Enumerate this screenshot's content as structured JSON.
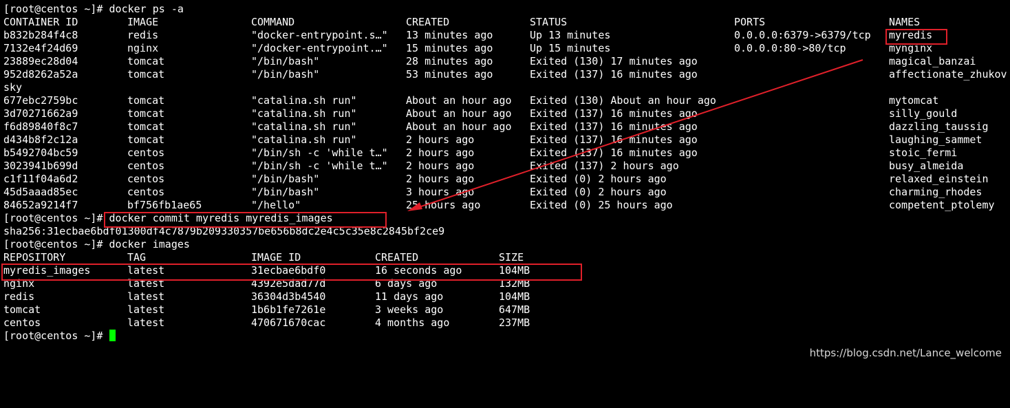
{
  "terminal": {
    "prompt": "[root@centos ~]# ",
    "cmd_ps": "docker ps -a",
    "ps_headers": [
      "CONTAINER ID",
      "IMAGE",
      "COMMAND",
      "CREATED",
      "STATUS",
      "PORTS",
      "NAMES"
    ],
    "containers": [
      {
        "id": "b832b284f4c8",
        "image": "redis",
        "command": "\"docker-entrypoint.s…\"",
        "created": "13 minutes ago",
        "status": "Up 13 minutes",
        "ports": "0.0.0.0:6379->6379/tcp",
        "name": "myredis"
      },
      {
        "id": "7132e4f24d69",
        "image": "nginx",
        "command": "\"/docker-entrypoint.…\"",
        "created": "15 minutes ago",
        "status": "Up 15 minutes",
        "ports": "0.0.0.0:80->80/tcp",
        "name": "mynginx"
      },
      {
        "id": "23889ec28d04",
        "image": "tomcat",
        "command": "\"/bin/bash\"",
        "created": "28 minutes ago",
        "status": "Exited (130) 17 minutes ago",
        "ports": "",
        "name": "magical_banzai"
      },
      {
        "id": "952d8262a52a",
        "image": "tomcat",
        "command": "\"/bin/bash\"",
        "created": "53 minutes ago",
        "status": "Exited (137) 16 minutes ago",
        "ports": "",
        "name": "affectionate_zhukov"
      },
      {
        "id": "677ebc2759bc",
        "image": "tomcat",
        "command": "\"catalina.sh run\"",
        "created": "About an hour ago",
        "status": "Exited (130) About an hour ago",
        "ports": "",
        "name": "mytomcat"
      },
      {
        "id": "3d70271662a9",
        "image": "tomcat",
        "command": "\"catalina.sh run\"",
        "created": "About an hour ago",
        "status": "Exited (137) 16 minutes ago",
        "ports": "",
        "name": "silly_gould"
      },
      {
        "id": "f6d89840f8c7",
        "image": "tomcat",
        "command": "\"catalina.sh run\"",
        "created": "About an hour ago",
        "status": "Exited (137) 16 minutes ago",
        "ports": "",
        "name": "dazzling_taussig"
      },
      {
        "id": "d434b8f2c12a",
        "image": "tomcat",
        "command": "\"catalina.sh run\"",
        "created": "2 hours ago",
        "status": "Exited (137) 16 minutes ago",
        "ports": "",
        "name": "laughing_sammet"
      },
      {
        "id": "b5492704bc59",
        "image": "centos",
        "command": "\"/bin/sh -c 'while t…\"",
        "created": "2 hours ago",
        "status": "Exited (137) 16 minutes ago",
        "ports": "",
        "name": "stoic_fermi"
      },
      {
        "id": "3023941b699d",
        "image": "centos",
        "command": "\"/bin/sh -c 'while t…\"",
        "created": "2 hours ago",
        "status": "Exited (137) 2 hours ago",
        "ports": "",
        "name": "busy_almeida"
      },
      {
        "id": "c1f11f04a6d2",
        "image": "centos",
        "command": "\"/bin/bash\"",
        "created": "2 hours ago",
        "status": "Exited (0) 2 hours ago",
        "ports": "",
        "name": "relaxed_einstein"
      },
      {
        "id": "45d5aaad85ec",
        "image": "centos",
        "command": "\"/bin/bash\"",
        "created": "3 hours ago",
        "status": "Exited (0) 2 hours ago",
        "ports": "",
        "name": "charming_rhodes"
      },
      {
        "id": "84652a9214f7",
        "image": "bf756fb1ae65",
        "command": "\"/hello\"",
        "created": "25 hours ago",
        "status": "Exited (0) 25 hours ago",
        "ports": "",
        "name": "competent_ptolemy"
      }
    ],
    "wrap_fragment": "sky",
    "cmd_commit": "docker commit myredis myredis_images",
    "commit_output": "sha256:31ecbae6bdf01300df4c7879b209330357be656b8dc2e4c5c35e8c2845bf2ce9",
    "cmd_images": "docker images",
    "images_headers": [
      "REPOSITORY",
      "TAG",
      "IMAGE ID",
      "CREATED",
      "SIZE"
    ],
    "images": [
      {
        "repo": "myredis_images",
        "tag": "latest",
        "id": "31ecbae6bdf0",
        "created": "16 seconds ago",
        "size": "104MB"
      },
      {
        "repo": "nginx",
        "tag": "latest",
        "id": "4392e5dad77d",
        "created": "6 days ago",
        "size": "132MB"
      },
      {
        "repo": "redis",
        "tag": "latest",
        "id": "36304d3b4540",
        "created": "11 days ago",
        "size": "104MB"
      },
      {
        "repo": "tomcat",
        "tag": "latest",
        "id": "1b6b1fe7261e",
        "created": "3 weeks ago",
        "size": "647MB"
      },
      {
        "repo": "centos",
        "tag": "latest",
        "id": "470671670cac",
        "created": "4 months ago",
        "size": "237MB"
      }
    ]
  },
  "colors": {
    "background": "#000000",
    "text": "#ffffff",
    "highlight": "#e0202a",
    "cursor": "#00ff00"
  },
  "watermark": "https://blog.csdn.net/Lance_welcome"
}
